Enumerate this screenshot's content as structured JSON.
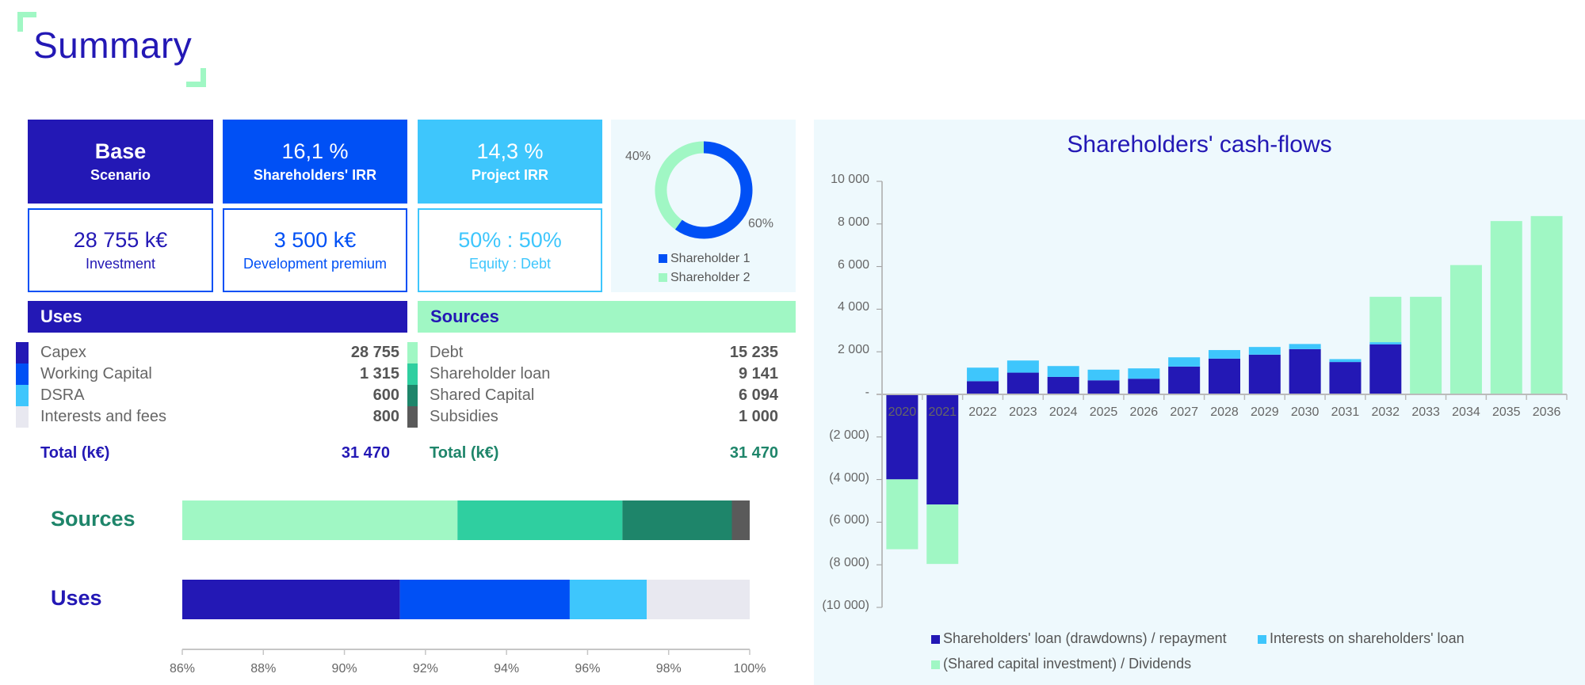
{
  "page": {
    "title": "Summary",
    "accent_color": "#2318b5",
    "corner_color": "#a0f7c4"
  },
  "kpis": {
    "scenario": {
      "value": "Base",
      "label": "Scenario",
      "color": "#2318b5"
    },
    "shareholders_irr": {
      "value": "16,1 %",
      "label": "Shareholders' IRR",
      "color": "#0050f5"
    },
    "project_irr": {
      "value": "14,3 %",
      "label": "Project IRR",
      "color": "#3ec6fc"
    },
    "investment": {
      "value": "28 755 k€",
      "label": "Investment"
    },
    "development_premium": {
      "value": "3 500 k€",
      "label": "Development premium"
    },
    "equity_debt": {
      "value": "50% : 50%",
      "label": "Equity : Debt"
    }
  },
  "shareholding": {
    "slices": [
      {
        "name": "Shareholder 1",
        "value": 60,
        "label": "60%",
        "color": "#0050f5"
      },
      {
        "name": "Shareholder 2",
        "value": 40,
        "label": "40%",
        "color": "#a0f7c4"
      }
    ]
  },
  "uses": {
    "header": "Uses",
    "items": [
      {
        "label": "Capex",
        "value": "28 755",
        "color": "#2318b5"
      },
      {
        "label": "Working Capital",
        "value": "1 315",
        "color": "#0050f5"
      },
      {
        "label": "DSRA",
        "value": "600",
        "color": "#3ec6fc"
      },
      {
        "label": "Interests and fees",
        "value": "800",
        "color": "#e8e8f0"
      }
    ],
    "total_label": "Total (k€)",
    "total_value": "31 470"
  },
  "sources": {
    "header": "Sources",
    "items": [
      {
        "label": "Debt",
        "value": "15 235",
        "color": "#a0f7c4"
      },
      {
        "label": "Shareholder loan",
        "value": "9 141",
        "color": "#2fcfa0"
      },
      {
        "label": "Shared Capital",
        "value": "6 094",
        "color": "#1e856a"
      },
      {
        "label": "Subsidies",
        "value": "1 000",
        "color": "#5a5a5a"
      }
    ],
    "total_label": "Total (k€)",
    "total_value": "31 470"
  },
  "chart_data": [
    {
      "type": "bar",
      "orientation": "horizontal-stacked",
      "title": "",
      "categories": [
        "Sources",
        "Uses"
      ],
      "xlim": [
        0.86,
        1.0
      ],
      "xticks": [
        "86%",
        "88%",
        "90%",
        "92%",
        "94%",
        "96%",
        "98%",
        "100%"
      ],
      "series": [
        {
          "category": "Sources",
          "cumulative_ends_pct": [
            92.79,
            96.86,
            99.56,
            100
          ],
          "colors": [
            "#a0f7c4",
            "#2fcfa0",
            "#1e856a",
            "#5a5a5a"
          ]
        },
        {
          "category": "Uses",
          "cumulative_ends_pct": [
            91.37,
            95.56,
            97.46,
            100
          ],
          "colors": [
            "#2318b5",
            "#0050f5",
            "#3ec6fc",
            "#e8e8f0"
          ]
        }
      ]
    },
    {
      "type": "bar",
      "orientation": "vertical-stacked",
      "title": "Shareholders' cash-flows",
      "xlabel": "",
      "ylabel": "",
      "ylim": [
        -10000,
        10000
      ],
      "yticks": [
        10000,
        8000,
        6000,
        4000,
        2000,
        0,
        -2000,
        -4000,
        -6000,
        -8000,
        -10000
      ],
      "ytick_labels": [
        "10 000",
        "8 000",
        "6 000",
        "4 000",
        "2 000",
        "-",
        "(2 000)",
        "(4 000)",
        "(6 000)",
        "(8 000)",
        "(10 000)"
      ],
      "categories": [
        "2020",
        "2021",
        "2022",
        "2023",
        "2024",
        "2025",
        "2026",
        "2027",
        "2028",
        "2029",
        "2030",
        "2031",
        "2032",
        "2033",
        "2034",
        "2035",
        "2036"
      ],
      "series": [
        {
          "name": "Shareholders' loan (drawdowns) / repayment",
          "color": "#2318b5",
          "values": [
            -3990,
            -5170,
            620,
            1020,
            820,
            660,
            735,
            1305,
            1680,
            1865,
            2125,
            1520,
            2350,
            0,
            0,
            0,
            0
          ]
        },
        {
          "name": "Interests on shareholders' loan",
          "color": "#3ec6fc",
          "values": [
            0,
            0,
            635,
            570,
            510,
            500,
            485,
            435,
            400,
            360,
            240,
            135,
            100,
            0,
            0,
            0,
            0
          ]
        },
        {
          "name": "(Shared capital investment) / Dividends",
          "color": "#a0f7c4",
          "values": [
            -3280,
            -2790,
            0,
            0,
            0,
            0,
            0,
            0,
            0,
            0,
            0,
            0,
            2130,
            4580,
            6070,
            8135,
            8370
          ]
        }
      ],
      "legend": "bottom"
    }
  ]
}
